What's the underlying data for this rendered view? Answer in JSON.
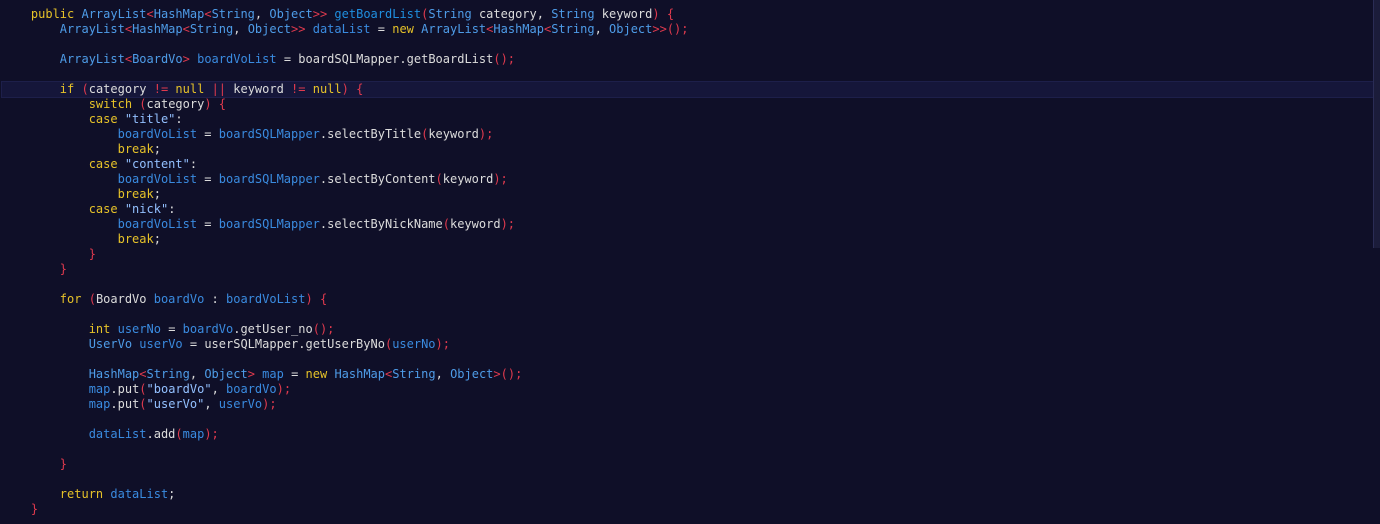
{
  "theme": {
    "background": "#0f0f28",
    "keyword": "#e6c229",
    "type": "#4e9ce8",
    "function": "#1f8fe0",
    "variable": "#3a8be0",
    "plain": "#dcdcdc",
    "punctuation": "#e03a4e",
    "string": "#93c0ff"
  },
  "code": {
    "current_line": 5,
    "lines": [
      [
        [
          "",
          "    "
        ],
        [
          "kw",
          "public "
        ],
        [
          "ty",
          "ArrayList"
        ],
        [
          "p",
          "<"
        ],
        [
          "ty",
          "HashMap"
        ],
        [
          "p",
          "<"
        ],
        [
          "ty",
          "String"
        ],
        [
          "plain",
          ", "
        ],
        [
          "ty",
          "Object"
        ],
        [
          "p",
          ">>"
        ],
        [
          "plain",
          " "
        ],
        [
          "fn",
          "getBoardList"
        ],
        [
          "p",
          "("
        ],
        [
          "ty",
          "String"
        ],
        [
          "plain",
          " category, "
        ],
        [
          "ty",
          "String"
        ],
        [
          "plain",
          " keyword"
        ],
        [
          "p",
          ")"
        ],
        [
          "plain",
          " "
        ],
        [
          "p",
          "{"
        ]
      ],
      [
        [
          "",
          "        "
        ],
        [
          "ty",
          "ArrayList"
        ],
        [
          "p",
          "<"
        ],
        [
          "ty",
          "HashMap"
        ],
        [
          "p",
          "<"
        ],
        [
          "ty",
          "String"
        ],
        [
          "plain",
          ", "
        ],
        [
          "ty",
          "Object"
        ],
        [
          "p",
          ">>"
        ],
        [
          "plain",
          " "
        ],
        [
          "var",
          "dataList"
        ],
        [
          "plain",
          " = "
        ],
        [
          "kw",
          "new "
        ],
        [
          "ty",
          "ArrayList"
        ],
        [
          "p",
          "<"
        ],
        [
          "ty",
          "HashMap"
        ],
        [
          "p",
          "<"
        ],
        [
          "ty",
          "String"
        ],
        [
          "plain",
          ", "
        ],
        [
          "ty",
          "Object"
        ],
        [
          "p",
          ">>();"
        ]
      ],
      [],
      [
        [
          "",
          "        "
        ],
        [
          "ty",
          "ArrayList"
        ],
        [
          "p",
          "<"
        ],
        [
          "ty",
          "BoardVo"
        ],
        [
          "p",
          ">"
        ],
        [
          "plain",
          " "
        ],
        [
          "var",
          "boardVoList"
        ],
        [
          "plain",
          " = boardSQLMapper."
        ],
        [
          "plain",
          "getBoardList"
        ],
        [
          "p",
          "();"
        ]
      ],
      [],
      [
        [
          "",
          "        "
        ],
        [
          "kw",
          "if "
        ],
        [
          "p",
          "("
        ],
        [
          "plain",
          "category "
        ],
        [
          "p",
          "!="
        ],
        [
          "kw",
          " null "
        ],
        [
          "p",
          "||"
        ],
        [
          "plain",
          " keyword "
        ],
        [
          "p",
          "!="
        ],
        [
          "kw",
          " null"
        ],
        [
          "p",
          ")"
        ],
        [
          "plain",
          " "
        ],
        [
          "p",
          "{"
        ]
      ],
      [
        [
          "",
          "            "
        ],
        [
          "kw",
          "switch "
        ],
        [
          "p",
          "("
        ],
        [
          "plain",
          "category"
        ],
        [
          "p",
          ")"
        ],
        [
          "plain",
          " "
        ],
        [
          "p",
          "{"
        ]
      ],
      [
        [
          "",
          "            "
        ],
        [
          "kw",
          "case "
        ],
        [
          "s",
          "\"title\""
        ],
        [
          "plain",
          ":"
        ]
      ],
      [
        [
          "",
          "                "
        ],
        [
          "var",
          "boardVoList"
        ],
        [
          "plain",
          " = "
        ],
        [
          "var",
          "boardSQLMapper"
        ],
        [
          "plain",
          ".selectByTitle"
        ],
        [
          "p",
          "("
        ],
        [
          "plain",
          "keyword"
        ],
        [
          "p",
          ");"
        ]
      ],
      [
        [
          "",
          "                "
        ],
        [
          "kw",
          "break"
        ],
        [
          "plain",
          ";"
        ]
      ],
      [
        [
          "",
          "            "
        ],
        [
          "kw",
          "case "
        ],
        [
          "s",
          "\"content\""
        ],
        [
          "plain",
          ":"
        ]
      ],
      [
        [
          "",
          "                "
        ],
        [
          "var",
          "boardVoList"
        ],
        [
          "plain",
          " = "
        ],
        [
          "var",
          "boardSQLMapper"
        ],
        [
          "plain",
          ".selectByContent"
        ],
        [
          "p",
          "("
        ],
        [
          "plain",
          "keyword"
        ],
        [
          "p",
          ");"
        ]
      ],
      [
        [
          "",
          "                "
        ],
        [
          "kw",
          "break"
        ],
        [
          "plain",
          ";"
        ]
      ],
      [
        [
          "",
          "            "
        ],
        [
          "kw",
          "case "
        ],
        [
          "s",
          "\"nick\""
        ],
        [
          "plain",
          ":"
        ]
      ],
      [
        [
          "",
          "                "
        ],
        [
          "var",
          "boardVoList"
        ],
        [
          "plain",
          " = "
        ],
        [
          "var",
          "boardSQLMapper"
        ],
        [
          "plain",
          ".selectByNickName"
        ],
        [
          "p",
          "("
        ],
        [
          "plain",
          "keyword"
        ],
        [
          "p",
          ");"
        ]
      ],
      [
        [
          "",
          "                "
        ],
        [
          "kw",
          "break"
        ],
        [
          "plain",
          ";"
        ]
      ],
      [
        [
          "",
          "            "
        ],
        [
          "p",
          "}"
        ]
      ],
      [
        [
          "",
          "        "
        ],
        [
          "p",
          "}"
        ]
      ],
      [],
      [
        [
          "",
          "        "
        ],
        [
          "kw",
          "for "
        ],
        [
          "p",
          "("
        ],
        [
          "plain",
          "BoardVo "
        ],
        [
          "var",
          "boardVo"
        ],
        [
          "plain",
          " : "
        ],
        [
          "var",
          "boardVoList"
        ],
        [
          "p",
          ")"
        ],
        [
          "plain",
          " "
        ],
        [
          "p",
          "{"
        ]
      ],
      [],
      [
        [
          "",
          "            "
        ],
        [
          "kw",
          "int "
        ],
        [
          "var",
          "userNo"
        ],
        [
          "plain",
          " = "
        ],
        [
          "var",
          "boardVo"
        ],
        [
          "plain",
          ".getUser_no"
        ],
        [
          "p",
          "();"
        ]
      ],
      [
        [
          "",
          "            "
        ],
        [
          "ty",
          "UserVo"
        ],
        [
          "plain",
          " "
        ],
        [
          "var",
          "userVo"
        ],
        [
          "plain",
          " = userSQLMapper.getUserByNo"
        ],
        [
          "p",
          "("
        ],
        [
          "var",
          "userNo"
        ],
        [
          "p",
          ");"
        ]
      ],
      [],
      [
        [
          "",
          "            "
        ],
        [
          "ty",
          "HashMap"
        ],
        [
          "p",
          "<"
        ],
        [
          "ty",
          "String"
        ],
        [
          "plain",
          ", "
        ],
        [
          "ty",
          "Object"
        ],
        [
          "p",
          ">"
        ],
        [
          "plain",
          " "
        ],
        [
          "var",
          "map"
        ],
        [
          "plain",
          " = "
        ],
        [
          "kw",
          "new "
        ],
        [
          "ty",
          "HashMap"
        ],
        [
          "p",
          "<"
        ],
        [
          "ty",
          "String"
        ],
        [
          "plain",
          ", "
        ],
        [
          "ty",
          "Object"
        ],
        [
          "p",
          ">();"
        ]
      ],
      [
        [
          "",
          "            "
        ],
        [
          "var",
          "map"
        ],
        [
          "plain",
          ".put"
        ],
        [
          "p",
          "("
        ],
        [
          "s",
          "\"boardVo\""
        ],
        [
          "plain",
          ", "
        ],
        [
          "var",
          "boardVo"
        ],
        [
          "p",
          ");"
        ]
      ],
      [
        [
          "",
          "            "
        ],
        [
          "var",
          "map"
        ],
        [
          "plain",
          ".put"
        ],
        [
          "p",
          "("
        ],
        [
          "s",
          "\"userVo\""
        ],
        [
          "plain",
          ", "
        ],
        [
          "var",
          "userVo"
        ],
        [
          "p",
          ");"
        ]
      ],
      [],
      [
        [
          "",
          "            "
        ],
        [
          "var",
          "dataList"
        ],
        [
          "plain",
          ".add"
        ],
        [
          "p",
          "("
        ],
        [
          "var",
          "map"
        ],
        [
          "p",
          ");"
        ]
      ],
      [],
      [
        [
          "",
          "        "
        ],
        [
          "p",
          "}"
        ]
      ],
      [],
      [
        [
          "",
          "        "
        ],
        [
          "kw",
          "return "
        ],
        [
          "var",
          "dataList"
        ],
        [
          "plain",
          ";"
        ]
      ],
      [
        [
          "",
          "    "
        ],
        [
          "p",
          "}"
        ]
      ]
    ]
  }
}
